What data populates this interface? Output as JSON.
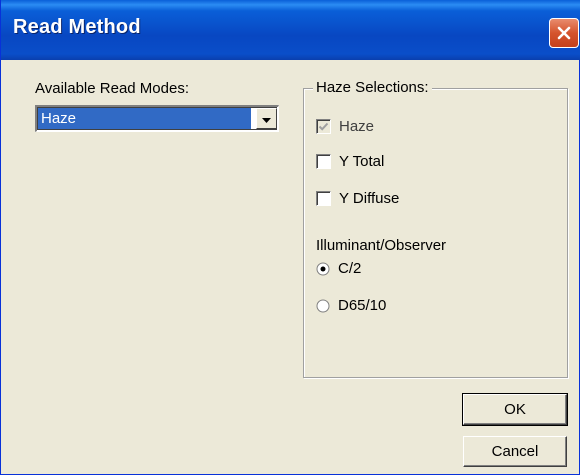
{
  "window": {
    "title": "Read Method",
    "close_icon": "close-icon"
  },
  "read_modes": {
    "label": "Available Read Modes:",
    "selected": "Haze"
  },
  "haze_selections": {
    "legend": "Haze Selections:",
    "checkboxes": [
      {
        "label": "Haze",
        "checked": true,
        "disabled": true
      },
      {
        "label": "Y Total",
        "checked": false,
        "disabled": false
      },
      {
        "label": "Y Diffuse",
        "checked": false,
        "disabled": false
      }
    ],
    "illuminant_label": "Illuminant/Observer",
    "radios": [
      {
        "label": "C/2",
        "selected": true
      },
      {
        "label": "D65/10",
        "selected": false
      }
    ]
  },
  "buttons": {
    "ok": "OK",
    "cancel": "Cancel"
  },
  "colors": {
    "titlebar": "#0847c2",
    "dialog_bg": "#ece9d8",
    "selection": "#316ac5",
    "close_button": "#d5542d"
  }
}
